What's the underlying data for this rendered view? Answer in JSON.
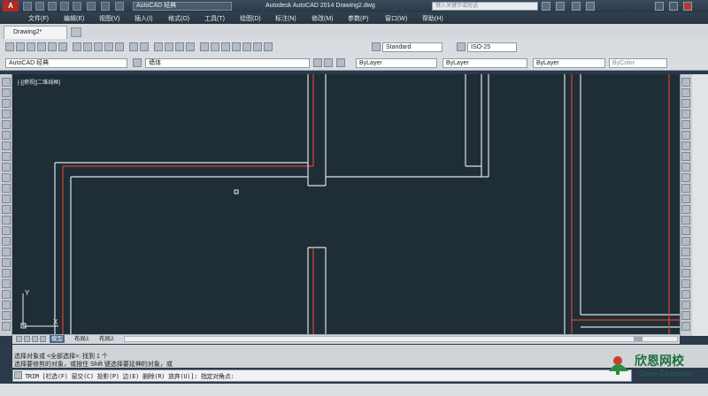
{
  "window": {
    "logo_text": "A",
    "workspace": "AutoCAD 经典",
    "title": "Autodesk AutoCAD 2014    Drawing2.dwg",
    "help_search_placeholder": "键入关键字或短语"
  },
  "menu": {
    "items": [
      "文件(F)",
      "编辑(E)",
      "视图(V)",
      "插入(I)",
      "格式(O)",
      "工具(T)",
      "绘图(D)",
      "标注(N)",
      "修改(M)",
      "参数(P)",
      "窗口(W)",
      "帮助(H)"
    ]
  },
  "document_tab": {
    "label": "Drawing2*"
  },
  "toolbar": {
    "workspace_combo": "AutoCAD 经典",
    "layer_combo": "墙体",
    "text_style_combo": "Standard",
    "dim_style_combo": "ISO-25",
    "color_combo": "ByLayer",
    "linetype_combo": "ByLayer",
    "lineweight_combo": "ByLayer",
    "plotstyle_combo": "ByColor"
  },
  "viewport": {
    "label": "[-][俯视][二维线框]"
  },
  "ucs": {
    "x_label": "X",
    "y_label": "Y"
  },
  "layout_tabs": [
    "模型",
    "布局1",
    "布局2"
  ],
  "command": {
    "history_1": "选择对象或 <全部选择>: 找到 1 个",
    "history_2": "选择要修剪的对象，或按住 Shift 键选择要延伸的对象，或",
    "prompt": "TRIM [栏选(F) 窗交(C) 投影(P) 边(E) 删除(R) 放弃(U)]: 指定对角点:"
  },
  "watermark": {
    "title": "欣恩网校",
    "subtitle": "Grace Education"
  },
  "colors": {
    "canvas": "#1f2d36",
    "wall_line": "#d9e2e8",
    "center_line": "#d9442f"
  }
}
